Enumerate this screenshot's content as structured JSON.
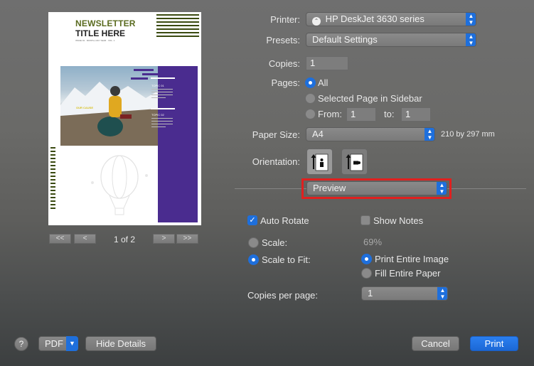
{
  "preview": {
    "thumbnail": {
      "headline_line1": "NEWSLETTER",
      "headline_line2": "TITLE HERE",
      "small_caption": "ISSUE 01 · MONTH, DAY YEAR · VOL. 1",
      "photo_caption": "OUR CAUSE",
      "topic1": "TOPIC 01",
      "topic2": "TOPIC 02",
      "accent_purple": "#4a2c8f",
      "accent_olive": "#5a6b1f"
    },
    "page_indicator": "1 of 2",
    "first_label": "<<",
    "prev_label": "<",
    "next_label": ">",
    "last_label": ">>"
  },
  "form": {
    "printer_label": "Printer:",
    "printer_value": "HP DeskJet 3630 series",
    "presets_label": "Presets:",
    "presets_value": "Default Settings",
    "copies_label": "Copies:",
    "copies_value": "1",
    "pages_label": "Pages:",
    "pages_all": "All",
    "pages_selected": "Selected Page in Sidebar",
    "pages_from": "From:",
    "pages_from_value": "1",
    "pages_to": "to:",
    "pages_to_value": "1",
    "paper_size_label": "Paper Size:",
    "paper_size_value": "A4",
    "paper_size_dims": "210 by 297 mm",
    "orientation_label": "Orientation:",
    "section_value": "Preview",
    "auto_rotate": "Auto Rotate",
    "show_notes": "Show Notes",
    "scale_label": "Scale:",
    "scale_value": "69%",
    "scale_to_fit": "Scale to Fit:",
    "print_entire_image": "Print Entire Image",
    "fill_entire_paper": "Fill Entire Paper",
    "copies_per_page_label": "Copies per page:",
    "copies_per_page_value": "1"
  },
  "footer": {
    "help": "?",
    "pdf": "PDF",
    "hide_details": "Hide Details",
    "cancel": "Cancel",
    "print": "Print"
  },
  "colors": {
    "accent": "#1e6fdc",
    "highlight_border": "#e0201f"
  }
}
